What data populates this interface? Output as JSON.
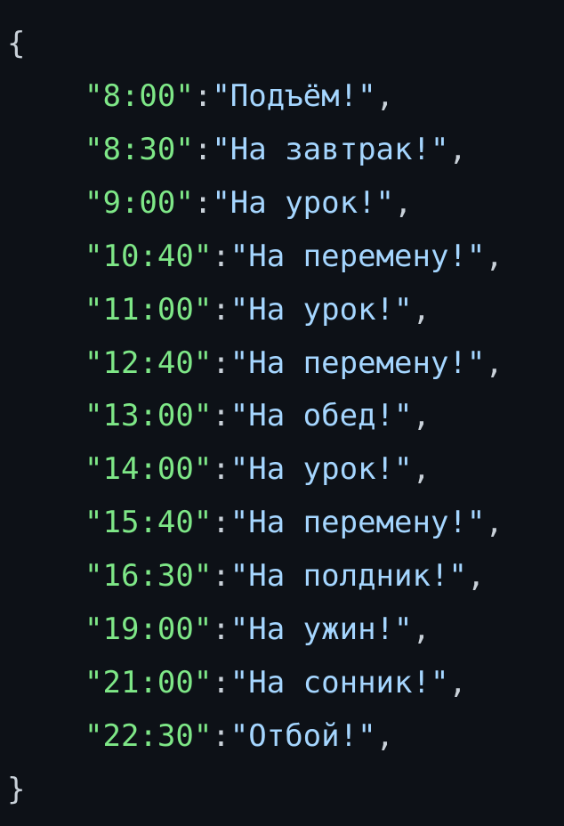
{
  "code": {
    "open_brace": "{",
    "close_brace": "}",
    "entries": [
      {
        "key": "\"8:00\"",
        "sep": ":",
        "value": "\"Подъём!\"",
        "comma": ","
      },
      {
        "key": "\"8:30\"",
        "sep": ":",
        "value": "\"На завтрак!\"",
        "comma": ","
      },
      {
        "key": "\"9:00\"",
        "sep": ":",
        "value": "\"На урок!\"",
        "comma": ","
      },
      {
        "key": "\"10:40\"",
        "sep": ":",
        "value": "\"На перемену!\"",
        "comma": ","
      },
      {
        "key": "\"11:00\"",
        "sep": ":",
        "value": "\"На урок!\"",
        "comma": ","
      },
      {
        "key": "\"12:40\"",
        "sep": ":",
        "value": "\"На перемену!\"",
        "comma": ","
      },
      {
        "key": "\"13:00\"",
        "sep": ":",
        "value": "\"На обед!\"",
        "comma": ","
      },
      {
        "key": "\"14:00\"",
        "sep": ":",
        "value": "\"На урок!\"",
        "comma": ","
      },
      {
        "key": "\"15:40\"",
        "sep": ":",
        "value": "\"На перемену!\"",
        "comma": ","
      },
      {
        "key": "\"16:30\"",
        "sep": ":",
        "value": "\"На полдник!\"",
        "comma": ","
      },
      {
        "key": "\"19:00\"",
        "sep": ":",
        "value": "\"На ужин!\"",
        "comma": ","
      },
      {
        "key": "\"21:00\"",
        "sep": ":",
        "value": "\"На сонник!\"",
        "comma": ","
      },
      {
        "key": "\"22:30\"",
        "sep": ":",
        "value": "\"Отбой!\"",
        "comma": ","
      }
    ]
  },
  "colors": {
    "background": "#0d1117",
    "key": "#7ee787",
    "value": "#a5d6ff",
    "punctuation": "#c9d1d9"
  }
}
